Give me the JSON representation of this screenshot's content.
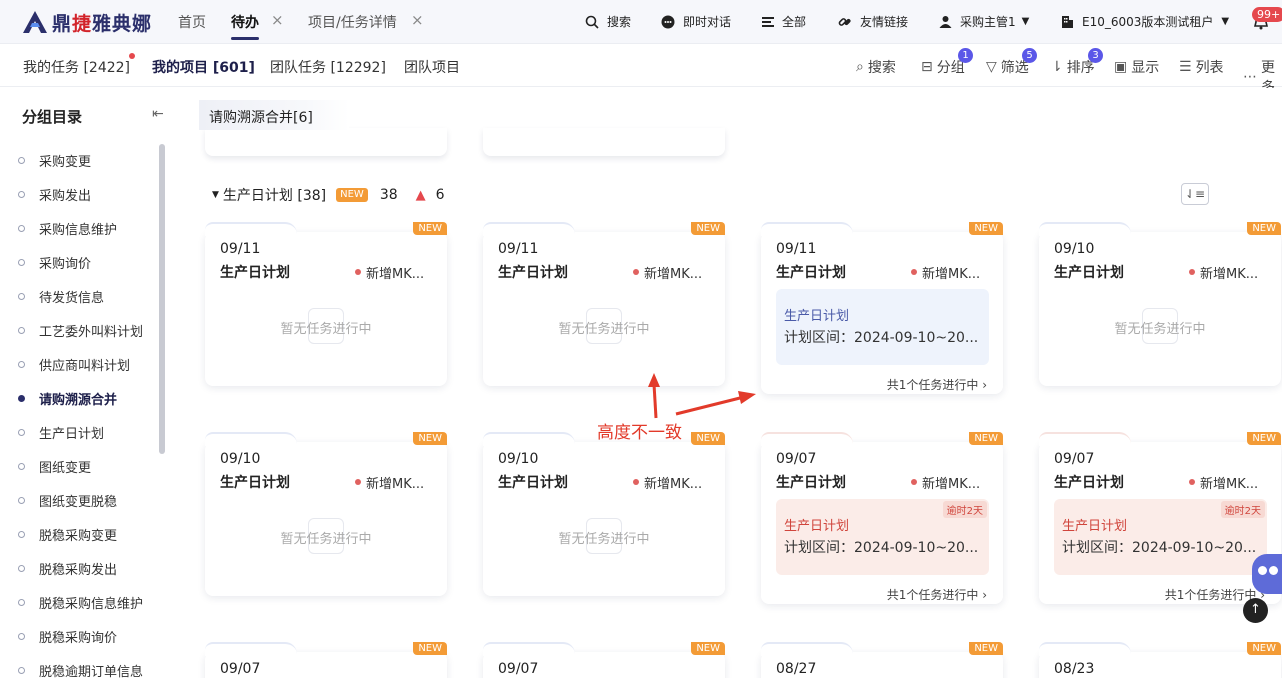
{
  "brand": {
    "name_a": "鼎",
    "name_b": "捷",
    "name_c": "雅典娜"
  },
  "nav_tabs": [
    {
      "label": "首页"
    },
    {
      "label": "待办"
    },
    {
      "label": "项目/任务详情"
    }
  ],
  "top_actions": {
    "search": "搜索",
    "chat": "即时对话",
    "all": "全部",
    "links": "友情链接",
    "user": "采购主管1",
    "tenant": "E10_6003版本测试租户",
    "notify_count": "99+"
  },
  "sub_tabs": [
    {
      "label": "我的任务 [2422]"
    },
    {
      "label": "我的项目 [601]"
    },
    {
      "label": "团队任务 [12292]"
    },
    {
      "label": "团队项目"
    }
  ],
  "toolbar": {
    "search": "搜索",
    "group": "分组",
    "group_count": "1",
    "filter": "筛选",
    "filter_count": "5",
    "sort": "排序",
    "sort_count": "3",
    "display": "显示",
    "list": "列表",
    "more": "更多"
  },
  "sidebar": {
    "title": "分组目录",
    "items": [
      {
        "label": "采购变更"
      },
      {
        "label": "采购发出"
      },
      {
        "label": "采购信息维护"
      },
      {
        "label": "采购询价"
      },
      {
        "label": "待发货信息"
      },
      {
        "label": "工艺委外叫料计划"
      },
      {
        "label": "供应商叫料计划"
      },
      {
        "label": "请购溯源合并"
      },
      {
        "label": "生产日计划"
      },
      {
        "label": "图纸变更"
      },
      {
        "label": "图纸变更脱稳"
      },
      {
        "label": "脱稳采购变更"
      },
      {
        "label": "脱稳采购发出"
      },
      {
        "label": "脱稳采购信息维护"
      },
      {
        "label": "脱稳采购询价"
      },
      {
        "label": "脱稳逾期订单信息"
      }
    ]
  },
  "group_chip": "请购溯源合并[6]",
  "section": {
    "title": "生产日计划 [38]",
    "new_label": "NEW",
    "new_count": "38",
    "warn_count": "6"
  },
  "cards": [
    {
      "date": "09/11",
      "name": "生产日计划",
      "tag": "新增MK...",
      "new": "NEW",
      "empty": "暂无任务进行中"
    },
    {
      "date": "09/11",
      "name": "生产日计划",
      "tag": "新增MK...",
      "new": "NEW",
      "empty": "暂无任务进行中"
    },
    {
      "date": "09/11",
      "name": "生产日计划",
      "tag": "新增MK...",
      "new": "NEW",
      "task_name": "生产日计划",
      "task_range": "计划区间：2024-09-10~20...",
      "more": "共1个任务进行中 ›"
    },
    {
      "date": "09/10",
      "name": "生产日计划",
      "tag": "新增MK...",
      "new": "NEW",
      "empty": "暂无任务进行中"
    },
    {
      "date": "09/10",
      "name": "生产日计划",
      "tag": "新增MK...",
      "new": "NEW",
      "empty": "暂无任务进行中"
    },
    {
      "date": "09/10",
      "name": "生产日计划",
      "tag": "新增MK...",
      "new": "NEW",
      "empty": "暂无任务进行中"
    },
    {
      "date": "09/07",
      "name": "生产日计划",
      "tag": "新增MK...",
      "new": "NEW",
      "task_name": "生产日计划",
      "task_range": "计划区间：2024-09-10~20...",
      "late": "逾时2天",
      "more": "共1个任务进行中 ›"
    },
    {
      "date": "09/07",
      "name": "生产日计划",
      "tag": "新增MK...",
      "new": "NEW",
      "task_name": "生产日计划",
      "task_range": "计划区间：2024-09-10~20...",
      "late": "逾时2天",
      "more": "共1个任务进行中 ›"
    },
    {
      "date": "09/07",
      "new": "NEW"
    },
    {
      "date": "09/07",
      "new": "NEW"
    },
    {
      "date": "08/27",
      "new": "NEW"
    },
    {
      "date": "08/23",
      "new": "NEW"
    }
  ],
  "annotation": "高度不一致",
  "colors": {
    "brand": "#2b2f6b",
    "accent_red": "#e23a2a",
    "new_tag": "#f39b36",
    "badge": "#5b57e8"
  }
}
